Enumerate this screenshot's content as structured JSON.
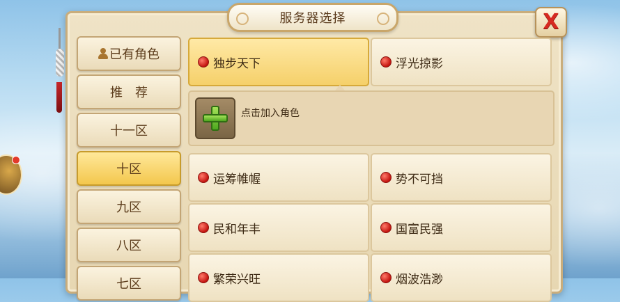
{
  "title": "服务器选择",
  "close_label": "X",
  "sidebar": {
    "items": [
      {
        "label": "已有角色",
        "icon": "person-icon",
        "active": false
      },
      {
        "label": "推　荐",
        "active": false
      },
      {
        "label": "十一区",
        "active": false
      },
      {
        "label": "十区",
        "active": true
      },
      {
        "label": "九区",
        "active": false
      },
      {
        "label": "八区",
        "active": false
      },
      {
        "label": "七区",
        "active": false
      }
    ]
  },
  "servers": [
    {
      "name": "独步天下",
      "selected": true
    },
    {
      "name": "浮光掠影",
      "selected": false
    },
    {
      "name": "运筹帷幄",
      "selected": false
    },
    {
      "name": "势不可挡",
      "selected": false
    },
    {
      "name": "民和年丰",
      "selected": false
    },
    {
      "name": "国富民强",
      "selected": false
    },
    {
      "name": "繁荣兴旺",
      "selected": false
    },
    {
      "name": "烟波浩渺",
      "selected": false
    }
  ],
  "add_role": {
    "label": "点击加入角色"
  },
  "colors": {
    "status_dot": "#c3140f",
    "selected": "#f5d06a",
    "close": "#d62a21"
  }
}
